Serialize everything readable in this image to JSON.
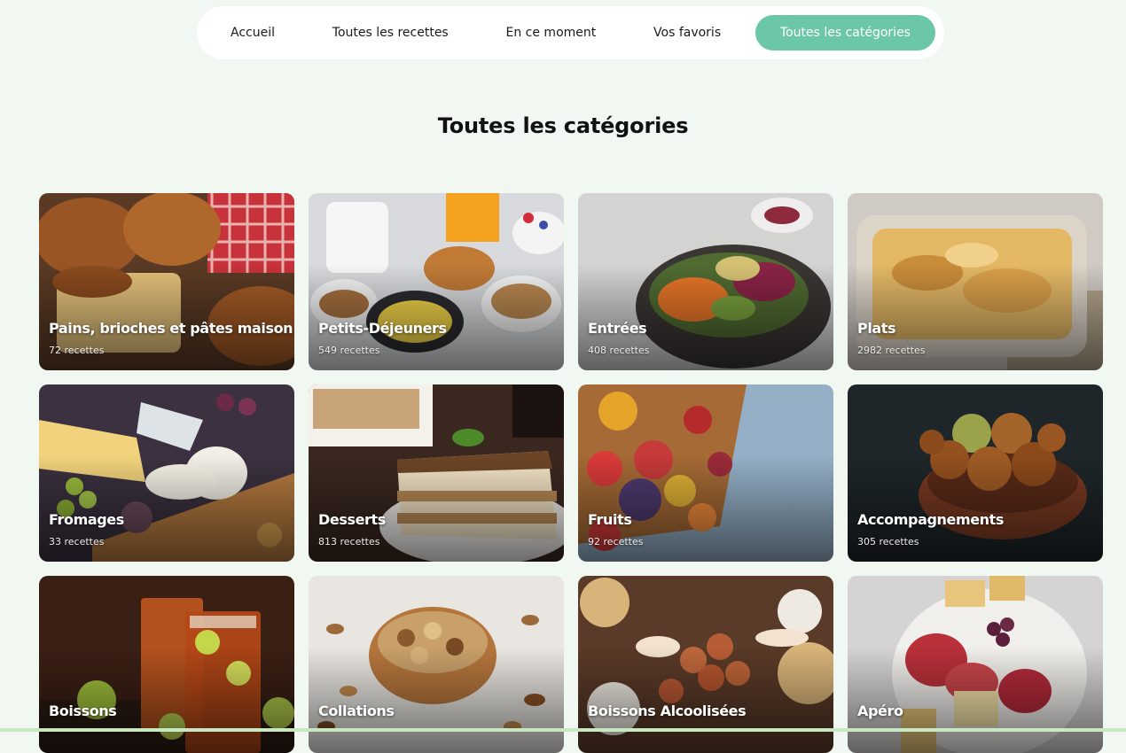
{
  "nav": {
    "items": [
      {
        "label": "Accueil"
      },
      {
        "label": "Toutes les recettes"
      },
      {
        "label": "En ce moment"
      },
      {
        "label": "Vos favoris"
      },
      {
        "label": "Toutes les catégories",
        "active": true
      }
    ]
  },
  "page_title": "Toutes les catégories",
  "categories": [
    {
      "label": "Pains, brioches et pâtes maison",
      "count": "72 recettes"
    },
    {
      "label": "Petits-Déjeuners",
      "count": "549 recettes"
    },
    {
      "label": "Entrées",
      "count": "408 recettes"
    },
    {
      "label": "Plats",
      "count": "2982 recettes"
    },
    {
      "label": "Fromages",
      "count": "33 recettes"
    },
    {
      "label": "Desserts",
      "count": "813 recettes"
    },
    {
      "label": "Fruits",
      "count": "92 recettes"
    },
    {
      "label": "Accompagnements",
      "count": "305 recettes"
    },
    {
      "label": "Boissons"
    },
    {
      "label": "Collations"
    },
    {
      "label": "Boissons Alcoolisées"
    },
    {
      "label": "Apéro"
    }
  ],
  "colors": {
    "page_background": "#f1f8f1",
    "active_tab": "#6cc6a8",
    "nav_background": "#ffffff"
  }
}
